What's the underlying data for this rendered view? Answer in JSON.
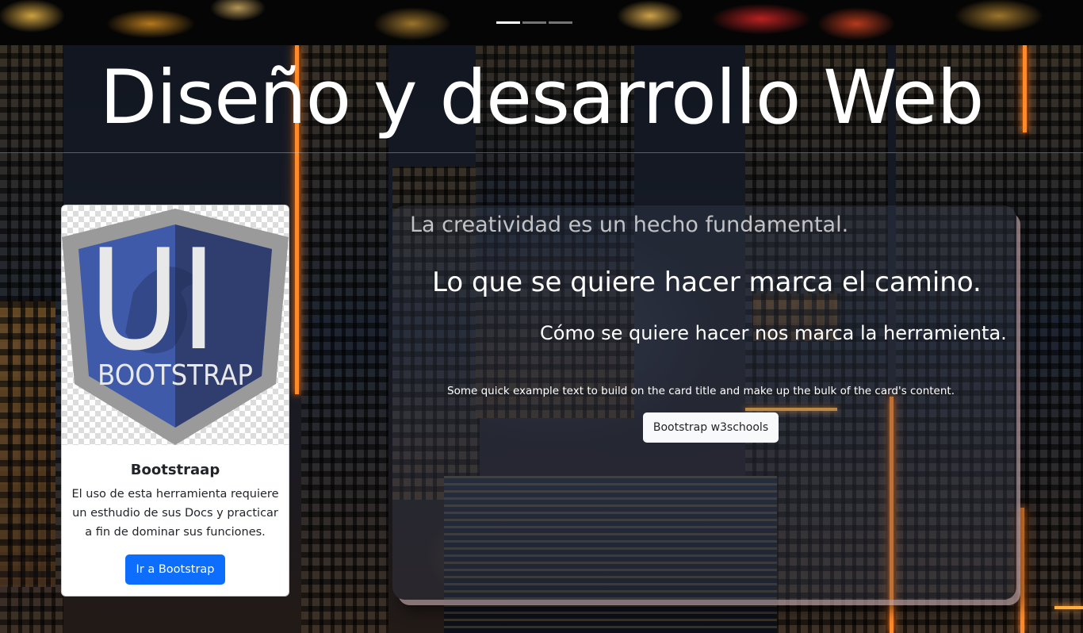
{
  "carousel": {
    "indicators": [
      {
        "label": "Slide 1",
        "active": true
      },
      {
        "label": "Slide 2",
        "active": false
      },
      {
        "label": "Slide 3",
        "active": false
      }
    ]
  },
  "header": {
    "title": "Diseño y desarrollo Web"
  },
  "card": {
    "image_text_top": "UI",
    "image_text_bottom": "BOOTSTRAP",
    "title": "Bootstraap",
    "text": "El uso de esta herramienta requiere un esthudio de sus Docs y practicar a fin de dominar sus funciones.",
    "button_label": "Ir a Bootstrap",
    "button_color": "#0d6efd"
  },
  "panel": {
    "line1": "La creatividad es un hecho fundamental.",
    "line2": "Lo que se quiere hacer marca el camino.",
    "line3": "Cómo se quiere hacer nos marca la herramienta.",
    "text": "Some quick example text to build on the card title and make up the bulk of the card's content.",
    "button_label": "Bootstrap w3schools"
  }
}
